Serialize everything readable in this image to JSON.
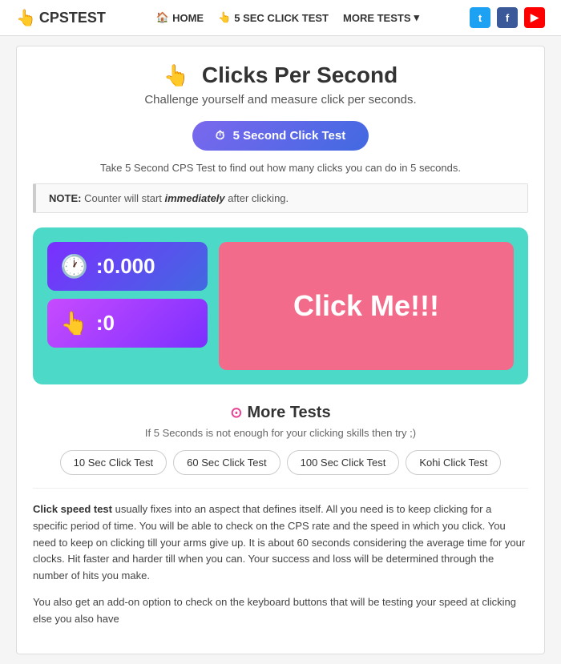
{
  "nav": {
    "logo_text": "CPSTEST",
    "logo_icon": "👆",
    "links": [
      {
        "id": "home",
        "label": "HOME",
        "icon": "🏠"
      },
      {
        "id": "click-test",
        "label": "5 SEC CLICK TEST",
        "icon": "👆"
      },
      {
        "id": "more-tests",
        "label": "MORE TESTS",
        "icon": "▾"
      }
    ],
    "social": [
      {
        "id": "twitter",
        "label": "t",
        "class": "twitter"
      },
      {
        "id": "facebook",
        "label": "f",
        "class": "facebook"
      },
      {
        "id": "youtube",
        "label": "▶",
        "class": "youtube"
      }
    ]
  },
  "header": {
    "icon": "👆",
    "title": "Clicks Per Second",
    "subtitle": "Challenge yourself and measure click per seconds."
  },
  "cta_button": {
    "icon": "⏱",
    "label": "5 Second Click Test"
  },
  "test_description": "Take 5 Second CPS Test to find out how many clicks you can do in 5 seconds.",
  "note": {
    "prefix": "NOTE:",
    "text": " Counter will start ",
    "highlight": "immediately",
    "suffix": " after clicking."
  },
  "click_area": {
    "timer_icon": "🕐",
    "timer_value": ":0.000",
    "click_icon": "👆",
    "click_count": ":0",
    "click_button_label": "Click Me!!!"
  },
  "more_tests": {
    "icon": "⊙",
    "title": "More Tests",
    "subtitle": "If 5 Seconds is not enough for your clicking skills then try ;)",
    "buttons": [
      {
        "id": "10sec",
        "label": "10 Sec Click Test"
      },
      {
        "id": "60sec",
        "label": "60 Sec Click Test"
      },
      {
        "id": "100sec",
        "label": "100 Sec Click Test"
      },
      {
        "id": "kohi",
        "label": "Kohi Click Test"
      }
    ]
  },
  "article": {
    "paragraphs": [
      "<strong>Click speed test</strong> usually fixes into an aspect that defines itself. All you need is to keep clicking for a specific period of time. You will be able to check on the CPS rate and the speed in which you click. You need to keep on clicking till your arms give up. It is about 60 seconds considering the average time for your clocks. Hit faster and harder till when you can. Your success and loss will be determined through the number of hits you make.",
      "You also get an add-on option to check on the keyboard buttons that will be testing your speed at clicking else you also have"
    ]
  }
}
